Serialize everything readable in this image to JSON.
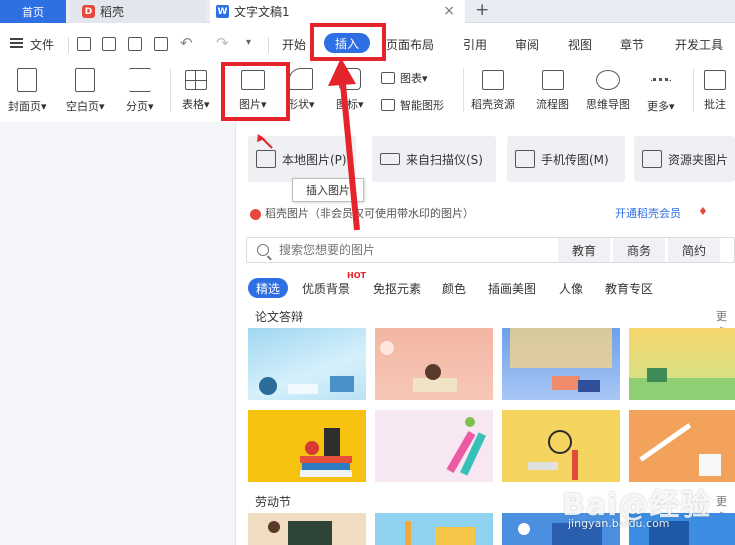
{
  "tabs": {
    "home": "首页",
    "daoke": "稻壳",
    "doc": "文字文稿1",
    "close": "×",
    "plus": "+"
  },
  "menu": {
    "file": "文件",
    "items": [
      "开始",
      "插入",
      "页面布局",
      "引用",
      "审阅",
      "视图",
      "章节",
      "开发工具"
    ]
  },
  "ribbon": {
    "cover": "封面页",
    "blank": "空白页",
    "pagebreak": "分页",
    "table": "表格",
    "picture": "图片",
    "shape": "形状",
    "icon": "图标",
    "chart": "图表",
    "smartart": "智能图形",
    "daoke_res": "稻壳资源",
    "flowchart": "流程图",
    "mindmap": "思维导图",
    "more": "更多",
    "comment": "批注",
    "dropdown": "▾"
  },
  "panel": {
    "local_pic": "本地图片(P)",
    "scanner": "来自扫描仪(S)",
    "phone": "手机传图(M)",
    "folder": "资源夹图片",
    "tooltip": "插入图片",
    "promo": "稻壳图片（非会员仅可使用带水印的图片）",
    "promo_link": "开通稻壳会员",
    "search_placeholder": "搜索您想要的图片",
    "search_cats": [
      "教育",
      "商务",
      "简约"
    ],
    "filters": [
      "精选",
      "优质背景",
      "免抠元素",
      "颜色",
      "插画美图",
      "人像",
      "教育专区"
    ],
    "hot": "HOT",
    "section1": "论文答辩",
    "section2": "劳动节",
    "more": "更多"
  },
  "watermark": {
    "main": "Bai@经验",
    "sub": "jingyan.baidu.com"
  },
  "colors": {
    "accent": "#2f6fe4",
    "highlight": "#e5232a"
  }
}
